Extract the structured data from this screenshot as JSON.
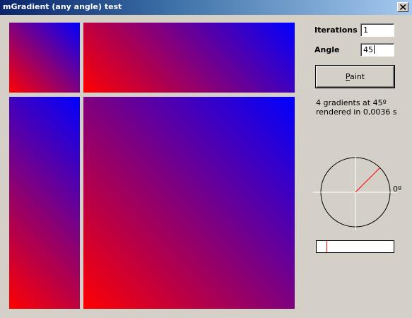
{
  "window": {
    "title": "mGradient (any angle) test"
  },
  "gradient": {
    "start_color": "#ff0000",
    "end_color": "#0000ff",
    "angle_degrees": 45
  },
  "controls": {
    "iterations_label": "Iterations",
    "iterations_value": "1",
    "angle_label": "Angle",
    "angle_value": "45",
    "paint_button_label": "Paint"
  },
  "status": {
    "line1": "4 gradients at 45º",
    "line2": "rendered in 0,0036 s"
  },
  "angle_dial": {
    "zero_label": "0º",
    "angle_degrees": 45,
    "indicator_color": "#ff0000"
  },
  "angle_bar": {
    "fraction": 0.125,
    "marker_color": "#ff0000"
  }
}
